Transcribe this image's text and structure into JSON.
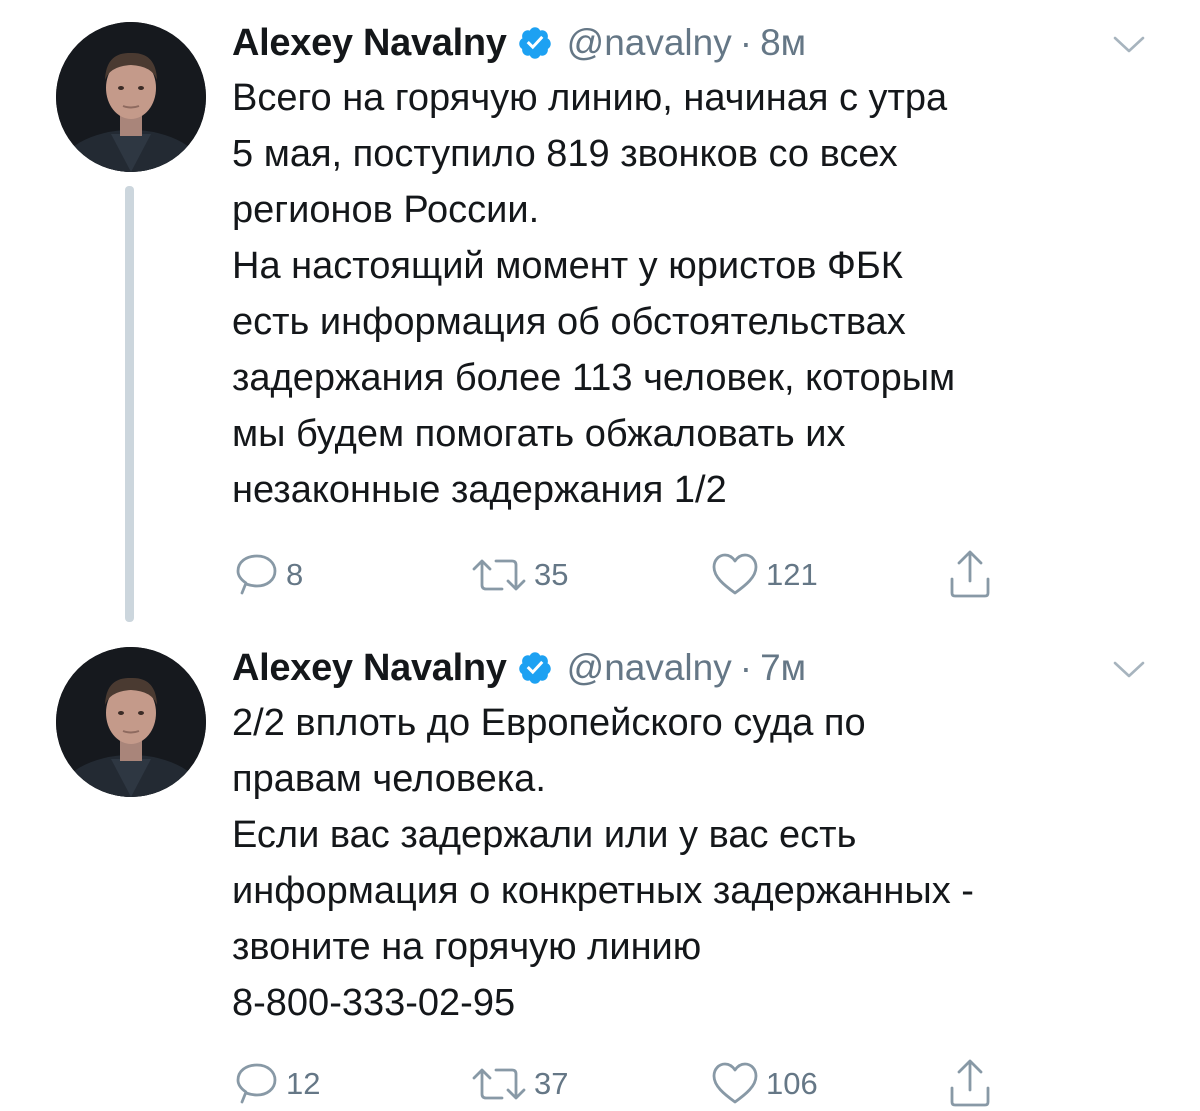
{
  "colors": {
    "text": "#14171a",
    "muted": "#657786",
    "verified": "#1da1f2",
    "thread_line": "#ccd6dd"
  },
  "icons": [
    "avatar",
    "verified-badge-icon",
    "chevron-down-icon",
    "reply-icon",
    "retweet-icon",
    "like-icon",
    "share-icon"
  ],
  "tweets": [
    {
      "author": {
        "name": "Alexey Navalny",
        "verified": true,
        "handle": "@navalny"
      },
      "separator": "·",
      "time": "8м",
      "text_lines": [
        "Всего на горячую линию, начиная с утра",
        "5 мая, поступило 819 звонков со всех",
        "регионов России.",
        "На настоящий момент у юристов ФБК",
        "есть информация об обстоятельствах",
        "задержания более 113 человек, которым",
        "мы будем помогать обжаловать их",
        "незаконные задержания 1/2"
      ],
      "stats": {
        "replies": "8",
        "retweets": "35",
        "likes": "121"
      }
    },
    {
      "author": {
        "name": "Alexey Navalny",
        "verified": true,
        "handle": "@navalny"
      },
      "separator": "·",
      "time": "7м",
      "text_lines": [
        "2/2 вплоть до Европейского суда по",
        "правам человека.",
        "Если вас задержали или у вас есть",
        "информация о конкретных задержанных -",
        "звоните на горячую линию",
        "8-800-333-02-95"
      ],
      "stats": {
        "replies": "12",
        "retweets": "37",
        "likes": "106"
      }
    }
  ]
}
